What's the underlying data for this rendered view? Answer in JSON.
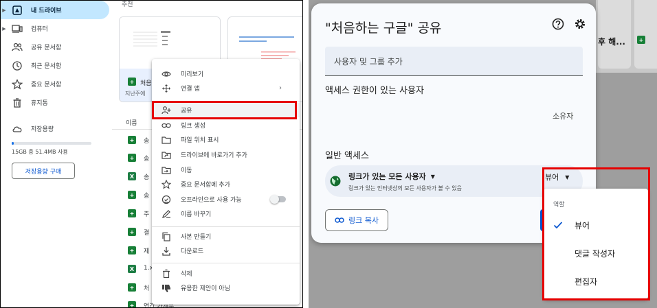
{
  "sidebar": {
    "items": [
      {
        "label": "내 드라이브",
        "icon": "my-drive-icon",
        "active": true
      },
      {
        "label": "컴퓨터",
        "icon": "computer-icon"
      },
      {
        "label": "공유 문서함",
        "icon": "shared-people-icon"
      },
      {
        "label": "최근 문서함",
        "icon": "clock-icon"
      },
      {
        "label": "중요 문서함",
        "icon": "star-icon"
      },
      {
        "label": "휴지통",
        "icon": "trash-icon"
      },
      {
        "label": "저장용량",
        "icon": "cloud-icon"
      }
    ],
    "storage_text": "15GB 중 51.4MB 사용",
    "storage_used_fraction": 0.0034,
    "buy_storage": "저장용량 구매"
  },
  "main": {
    "section_label": "추천",
    "card_title": "처음",
    "card_sub": "지난주에 ",
    "column_name": "이름",
    "rows": [
      {
        "type": "sheet",
        "name": "송"
      },
      {
        "type": "sheet",
        "name": "송"
      },
      {
        "type": "xls",
        "name": "송"
      },
      {
        "type": "sheet",
        "name": "송"
      },
      {
        "type": "sheet",
        "name": "주"
      },
      {
        "type": "sheet",
        "name": "결"
      },
      {
        "type": "sheet",
        "name": "제"
      },
      {
        "type": "xls",
        "name": "1.x"
      },
      {
        "type": "sheet",
        "name": "처"
      },
      {
        "type": "sheet",
        "name": "연간 가계부"
      }
    ]
  },
  "context_menu": {
    "items": [
      {
        "label": "미리보기",
        "icon": "eye-icon"
      },
      {
        "label": "연결 앱",
        "icon": "move-arrows-icon",
        "submenu": true
      },
      {
        "label": "공유",
        "icon": "person-add-icon"
      },
      {
        "label": "링크 생성",
        "icon": "link-icon"
      },
      {
        "label": "파일 위치 표시",
        "icon": "folder-icon"
      },
      {
        "label": "드라이브에 바로가기 추가",
        "icon": "shortcut-icon"
      },
      {
        "label": "이동",
        "icon": "move-to-icon"
      },
      {
        "label": "중요 문서함에 추가",
        "icon": "star-outline-icon"
      },
      {
        "label": "오프라인으로 사용 가능",
        "icon": "offline-check-icon",
        "toggle": true
      },
      {
        "label": "이름 바꾸기",
        "icon": "pencil-icon"
      },
      {
        "label": "사본 만들기",
        "icon": "copy-icon"
      },
      {
        "label": "다운로드",
        "icon": "download-icon"
      },
      {
        "label": "삭제",
        "icon": "delete-icon"
      },
      {
        "label": "유용한 제안이 아님",
        "icon": "thumb-down-icon"
      }
    ]
  },
  "background_cards": {
    "card_text": "후 해..."
  },
  "share_dialog": {
    "title": "\"처음하는 구글\" 공유",
    "add_people_placeholder": "사용자 및 그룹 추가",
    "access_header": "액세스 권한이 있는 사용자",
    "owner_label": "소유자",
    "general_access_header": "일반 액세스",
    "link_option": "링크가 있는 모든 사용자",
    "link_description": "링크가 있는 인터넷상의 모든 사용자가 볼 수 있음",
    "role_selected": "뷰어",
    "copy_link": "링크 복사"
  },
  "role_dropdown": {
    "header": "역할",
    "options": [
      {
        "label": "뷰어",
        "checked": true
      },
      {
        "label": "댓글 작성자",
        "checked": false
      },
      {
        "label": "편집자",
        "checked": false
      }
    ]
  },
  "colors": {
    "accent": "#0b57d0",
    "highlight": "#e60000",
    "sheet_green": "#188038"
  }
}
